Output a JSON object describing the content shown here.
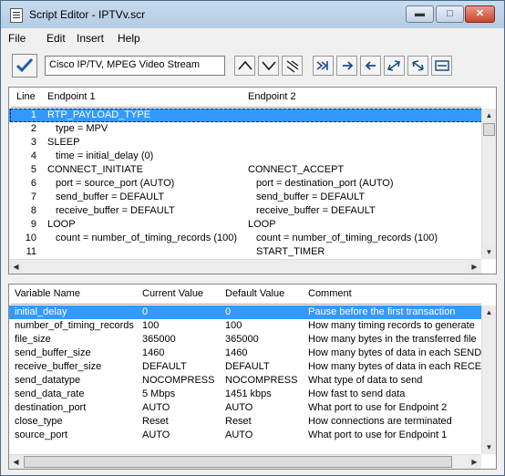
{
  "window": {
    "title": "Script Editor - IPTVv.scr"
  },
  "window_controls": {
    "minimize": "▬",
    "maximize": "□",
    "close": "✕"
  },
  "menu": [
    "File",
    "Edit",
    "Insert",
    "Help"
  ],
  "toolbar": {
    "script_title_value": "Cisco IP/TV, MPEG Video Stream",
    "buttons": [
      "check-icon",
      "chevron-up-icon",
      "chevron-down-icon",
      "collapse-icon",
      "jump-all-icon",
      "arrow-right-icon",
      "arrow-left-icon",
      "swap-icon",
      "swap-back-icon",
      "split-icon"
    ]
  },
  "script": {
    "headers": {
      "line": "Line",
      "endpoint1": "Endpoint 1",
      "endpoint2": "Endpoint 2"
    },
    "rows": [
      {
        "line": "1",
        "ep1": "RTP_PAYLOAD_TYPE",
        "ep2": "",
        "selected": true,
        "indent1": false,
        "indent2": false
      },
      {
        "line": "2",
        "ep1": "type = MPV",
        "ep2": "",
        "indent1": true,
        "indent2": false
      },
      {
        "line": "3",
        "ep1": "SLEEP",
        "ep2": "",
        "indent1": false,
        "indent2": false
      },
      {
        "line": "4",
        "ep1": "time = initial_delay (0)",
        "ep2": "",
        "indent1": true,
        "indent2": false
      },
      {
        "line": "5",
        "ep1": "CONNECT_INITIATE",
        "ep2": "CONNECT_ACCEPT",
        "indent1": false,
        "indent2": false
      },
      {
        "line": "6",
        "ep1": "port = source_port (AUTO)",
        "ep2": "port = destination_port (AUTO)",
        "indent1": true,
        "indent2": true
      },
      {
        "line": "7",
        "ep1": "send_buffer = DEFAULT",
        "ep2": "send_buffer = DEFAULT",
        "indent1": true,
        "indent2": true
      },
      {
        "line": "8",
        "ep1": "receive_buffer = DEFAULT",
        "ep2": "receive_buffer = DEFAULT",
        "indent1": true,
        "indent2": true
      },
      {
        "line": "9",
        "ep1": "LOOP",
        "ep2": "LOOP",
        "indent1": false,
        "indent2": false
      },
      {
        "line": "10",
        "ep1": "count = number_of_timing_records (100)",
        "ep2": "count = number_of_timing_records (100)",
        "indent1": true,
        "indent2": true
      },
      {
        "line": "11",
        "ep1": "",
        "ep2": "START_TIMER",
        "indent1": false,
        "indent2": true
      }
    ]
  },
  "variables": {
    "headers": {
      "name": "Variable Name",
      "current": "Current Value",
      "default": "Default Value",
      "comment": "Comment"
    },
    "rows": [
      {
        "name": "initial_delay",
        "current": "0",
        "default": "0",
        "comment": "Pause before the first transaction",
        "selected": true
      },
      {
        "name": "number_of_timing_records",
        "current": "100",
        "default": "100",
        "comment": "How many timing records to generate"
      },
      {
        "name": "file_size",
        "current": "365000",
        "default": "365000",
        "comment": "How many bytes in the transferred file"
      },
      {
        "name": "send_buffer_size",
        "current": "1460",
        "default": "1460",
        "comment": "How many bytes of data in each SEND"
      },
      {
        "name": "receive_buffer_size",
        "current": "DEFAULT",
        "default": "DEFAULT",
        "comment": "How many bytes of data in each RECEIVE"
      },
      {
        "name": "send_datatype",
        "current": "NOCOMPRESS",
        "default": "NOCOMPRESS",
        "comment": "What type of data to send"
      },
      {
        "name": "send_data_rate",
        "current": "5 Mbps",
        "default": "1451 kbps",
        "comment": "How fast to send data"
      },
      {
        "name": "destination_port",
        "current": "AUTO",
        "default": "AUTO",
        "comment": "What port to use for Endpoint 2"
      },
      {
        "name": "close_type",
        "current": "Reset",
        "default": "Reset",
        "comment": "How connections are terminated"
      },
      {
        "name": "source_port",
        "current": "AUTO",
        "default": "AUTO",
        "comment": "What port to use for Endpoint 1"
      }
    ]
  },
  "colors": {
    "selection": "#3399ff",
    "titlebar": "#b3cbe3"
  }
}
